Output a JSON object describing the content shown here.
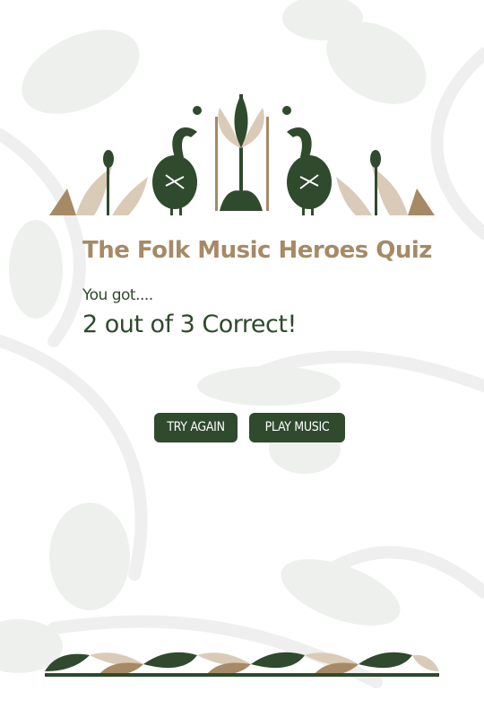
{
  "colors": {
    "primary": "#2f4a2d",
    "accent": "#a68a66",
    "beige": "#d9cbb8",
    "background_pattern": "#eeeeee"
  },
  "quiz": {
    "title": "The Folk Music Heroes Quiz",
    "result_intro": "You got....",
    "result_score": "2 out of 3 Correct!"
  },
  "actions": {
    "try_again_label": "TRY AGAIN",
    "play_music_label": "PLAY MUSIC"
  }
}
